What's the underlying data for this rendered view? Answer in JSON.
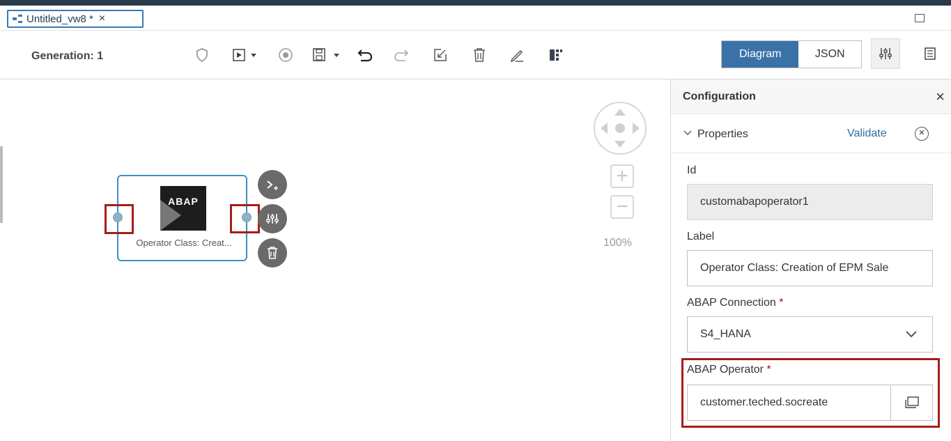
{
  "tab": {
    "title": "Untitled_vw8 *",
    "close": "×"
  },
  "toolbar": {
    "generation": "Generation: 1",
    "diagram_label": "Diagram",
    "json_label": "JSON"
  },
  "canvas": {
    "node_label": "Operator Class: Creat...",
    "node_logo_text": "ABAP",
    "zoom_level": "100%"
  },
  "panel": {
    "title": "Configuration",
    "close": "×",
    "section_title": "Properties",
    "validate_label": "Validate",
    "id_label": "Id",
    "id_value": "customabapoperator1",
    "label_label": "Label",
    "label_value": "Operator Class: Creation of EPM Sale",
    "connection_label": "ABAP Connection",
    "connection_required": "*",
    "connection_value": "S4_HANA",
    "operator_label": "ABAP Operator",
    "operator_required": "*",
    "operator_value": "customer.teched.socreate"
  },
  "colors": {
    "accent": "#3a72a8",
    "highlight": "#a51d1d",
    "node_border": "#3a90c4"
  },
  "icons": [
    "tab-graph-icon",
    "maximize-icon",
    "validate-shield-icon",
    "run-icon",
    "stop-icon",
    "save-icon",
    "undo-icon",
    "redo-icon",
    "edit-icon",
    "delete-icon",
    "pen-icon",
    "layout-icon",
    "settings-icon",
    "document-icon",
    "terminal-plus-icon",
    "node-settings-icon",
    "trash-icon",
    "pan-navigator-icon",
    "zoom-in-icon",
    "zoom-out-icon",
    "chevron-down-icon",
    "value-help-icon"
  ]
}
